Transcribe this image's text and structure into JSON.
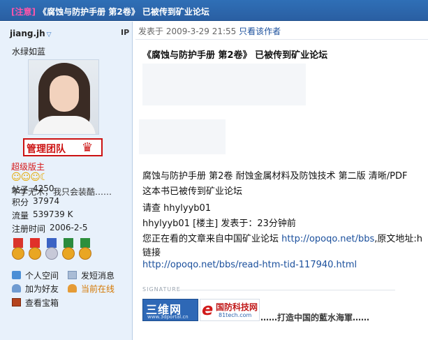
{
  "title_bar": {
    "tag": "[注意]",
    "text": "《腐蚀与防护手册 第2卷》 已被传到矿业论坛"
  },
  "user": {
    "name": "jiang.jh",
    "ip_label": "IP",
    "motto": "水绿如蓝",
    "group_badge": "管理团队",
    "role": "超级版主",
    "signature_short": "不学无术，我只会装酷……",
    "stats": [
      {
        "label": "帖子",
        "value": "4250"
      },
      {
        "label": "积分",
        "value": "37974"
      },
      {
        "label": "流量",
        "value": "539739 K"
      },
      {
        "label": "注册时间",
        "value": "2006-2-5"
      }
    ],
    "actions": {
      "space": "个人空间",
      "message": "发短消息",
      "add_friend": "加为好友",
      "online": "当前在线",
      "treasure": "查看宝箱"
    }
  },
  "post": {
    "posted_label": "发表于 2009-3-29 21:55",
    "only_author": "只看该作者",
    "title": "《腐蚀与防护手册 第2卷》 已被传到矿业论坛",
    "lines": [
      "腐蚀与防护手册 第2卷 耐蚀金属材料及防蚀技术 第二版 清晰/PDF",
      "这本书已被传到矿业论坛",
      "请查  hhylyyb01",
      "hhylyyb01 [楼主] 发表于：23分钟前",
      "您正在看的文章来自中国矿业论坛 ",
      "http://opoqo.net/bbs",
      ",原文地址:h",
      "链接",
      "http://opoqo.net/bbs/read-htm-tid-117940.html"
    ]
  },
  "signature": {
    "label": "SIGNATURE",
    "logo1_big": "三维网",
    "logo1_small": "www.3dportal.cn",
    "logo2_big": "国防科技网",
    "logo2_small": "81tech.com",
    "slogan": "……打造中国的藍水海軍……"
  }
}
